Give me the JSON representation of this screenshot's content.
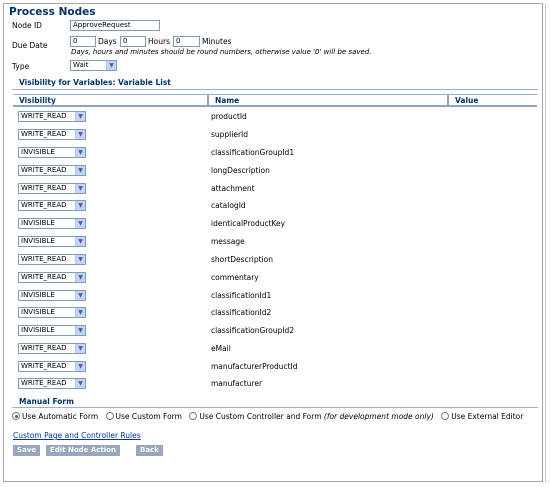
{
  "page": {
    "title": "Process Nodes"
  },
  "node": {
    "id_label": "Node ID",
    "id_value": "ApproveRequest",
    "due_label": "Due Date",
    "days_value": "0",
    "days_label": "Days",
    "hours_value": "0",
    "hours_label": "Hours",
    "minutes_value": "0",
    "minutes_label": "Minutes",
    "due_hint": "Days, hours and minutes should be round numbers, otherwise value '0' will be saved.",
    "type_label": "Type",
    "type_value": "Wait"
  },
  "variables": {
    "heading": "Visibility for Variables: Variable List",
    "columns": [
      "Visibility",
      "Name",
      "Value"
    ],
    "rows": [
      {
        "visibility": "WRITE_READ",
        "name": "productId"
      },
      {
        "visibility": "WRITE_READ",
        "name": "supplierId"
      },
      {
        "visibility": "INVISIBLE",
        "name": "classificationGroupId1"
      },
      {
        "visibility": "WRITE_READ",
        "name": "longDescription"
      },
      {
        "visibility": "WRITE_READ",
        "name": "attachment"
      },
      {
        "visibility": "WRITE_READ",
        "name": "catalogId"
      },
      {
        "visibility": "INVISIBLE",
        "name": "identicalProductKey"
      },
      {
        "visibility": "INVISIBLE",
        "name": "message"
      },
      {
        "visibility": "WRITE_READ",
        "name": "shortDescription"
      },
      {
        "visibility": "WRITE_READ",
        "name": "commentary"
      },
      {
        "visibility": "INVISIBLE",
        "name": "classificationId1"
      },
      {
        "visibility": "INVISIBLE",
        "name": "classificationId2"
      },
      {
        "visibility": "INVISIBLE",
        "name": "classificationGroupId2"
      },
      {
        "visibility": "WRITE_READ",
        "name": "eMail"
      },
      {
        "visibility": "WRITE_READ",
        "name": "manufacturerProductId"
      },
      {
        "visibility": "WRITE_READ",
        "name": "manufacturer"
      }
    ]
  },
  "manual_form": {
    "heading": "Manual Form",
    "options": [
      {
        "label": "Use Automatic Form",
        "selected": true
      },
      {
        "label": "Use Custom Form",
        "selected": false
      },
      {
        "label": "Use Custom Controller and Form",
        "note": "(for development mode only)",
        "selected": false
      },
      {
        "label": "Use External Editor",
        "selected": false
      }
    ],
    "rules_link": "Custom Page and Controller Rules"
  },
  "buttons": {
    "save": "Save",
    "edit_node_action": "Edit Node Action",
    "back": "Back"
  },
  "colors": {
    "heading": "#003366",
    "button_bg": "#99a6bf",
    "link": "#003399"
  }
}
